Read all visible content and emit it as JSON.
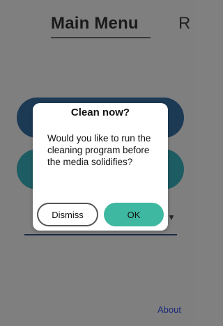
{
  "header": {
    "title": "Main Menu",
    "corner_text": "R"
  },
  "footer": {
    "about_label": "About"
  },
  "dialog": {
    "title": "Clean now?",
    "message": "Would you like to run the cleaning program before the media solidifies?",
    "dismiss_label": "Dismiss",
    "ok_label": "OK"
  },
  "colors": {
    "overlay_dim": "#7f7f7f",
    "ok_button": "#3eb8a0",
    "bg_button_dark": "#1d3a55",
    "bg_button_teal": "#1e5c63"
  }
}
